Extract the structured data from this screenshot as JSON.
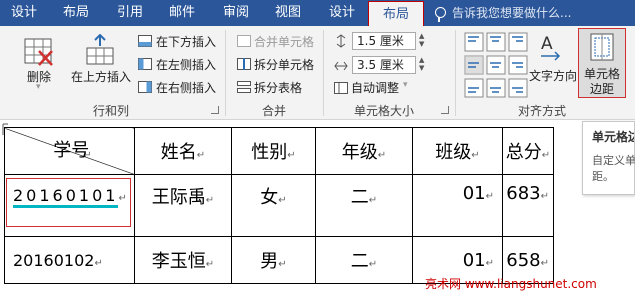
{
  "tabs": [
    {
      "label": "设计"
    },
    {
      "label": "布局"
    },
    {
      "label": "引用"
    },
    {
      "label": "邮件"
    },
    {
      "label": "审阅"
    },
    {
      "label": "视图"
    },
    {
      "label": "设计"
    },
    {
      "label": "布局"
    }
  ],
  "search_placeholder": "告诉我您想要做什么...",
  "ribbon": {
    "delete_label": "删除",
    "insert_above_label": "在上方插入",
    "insert_below_label": "在下方插入",
    "insert_left_label": "在左侧插入",
    "insert_right_label": "在右侧插入",
    "rows_cols_group": "行和列",
    "merge_cells_label": "合并单元格",
    "split_cells_label": "拆分单元格",
    "split_table_label": "拆分表格",
    "merge_group": "合并",
    "height_value": "1.5 厘米",
    "width_value": "3.5 厘米",
    "autofit_label": "自动调整",
    "cell_size_group": "单元格大小",
    "text_direction_label": "文字方向",
    "cell_margins_line1": "单元格",
    "cell_margins_line2": "边距",
    "align_group": "对齐方式"
  },
  "tooltip": {
    "title": "单元格边",
    "desc_line1": "自定义单",
    "desc_line2": "距。"
  },
  "table": {
    "headers": [
      "学号",
      "姓名",
      "性别",
      "年级",
      "班级",
      "总分"
    ],
    "rows": [
      [
        "20160101",
        "王际禹",
        "女",
        "二",
        "01",
        "683"
      ],
      [
        "20160102",
        "李玉恒",
        "男",
        "二",
        "01",
        "658"
      ]
    ]
  },
  "para_mark": "↵",
  "watermark": "亮术网 www.liangshunet.com",
  "colors": {
    "tab_bar": "#2b579a",
    "selection_border": "#d03030",
    "accent_underline": "#00b7c3"
  }
}
